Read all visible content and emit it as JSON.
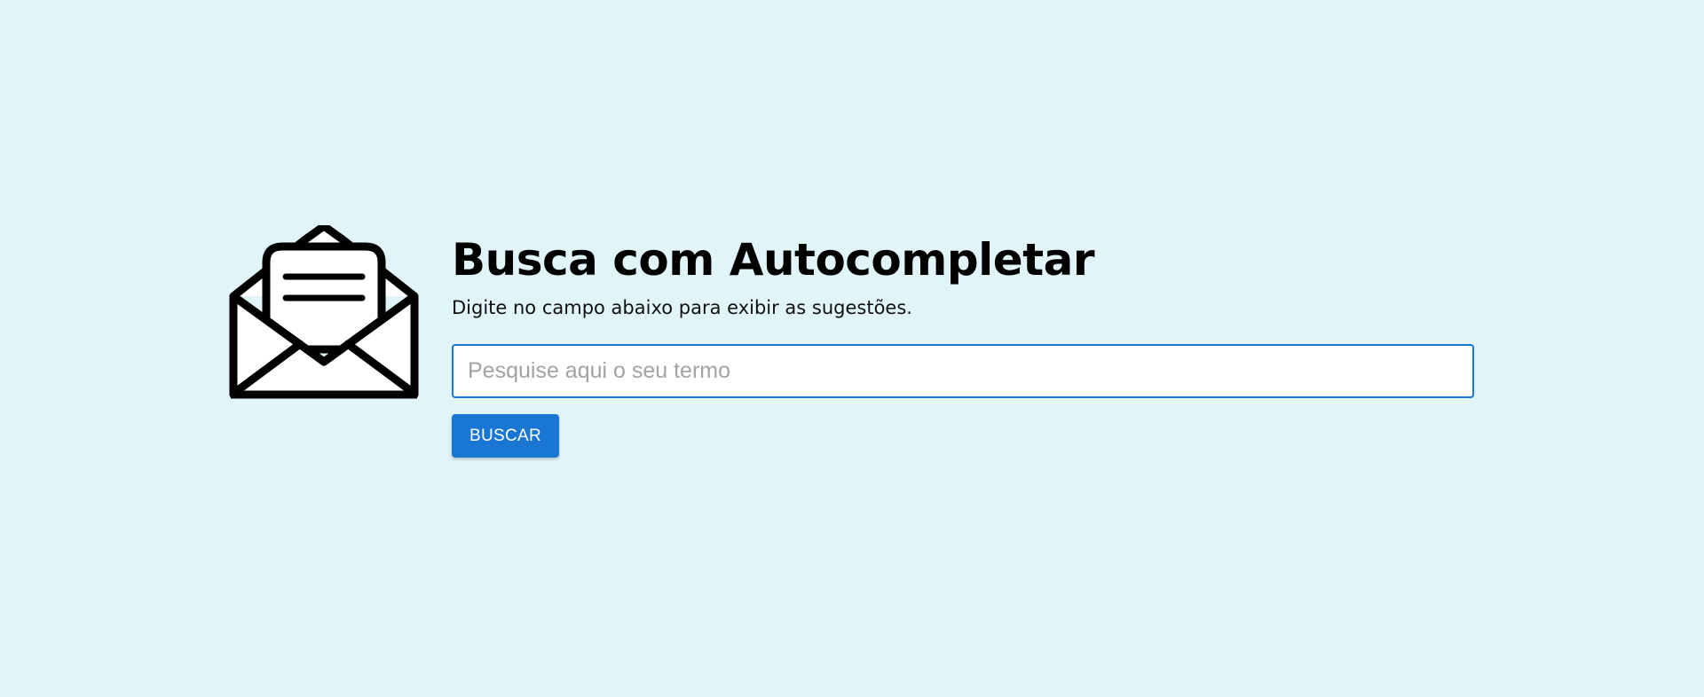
{
  "page": {
    "title": "Busca com Autocompletar",
    "subtitle": "Digite no campo abaixo para exibir as sugestões."
  },
  "search": {
    "placeholder": "Pesquise aqui o seu termo",
    "value": "",
    "button_label": "BUSCAR"
  },
  "icon": {
    "name": "open-envelope-icon"
  },
  "colors": {
    "background": "#e1f4f8",
    "accent": "#1976d2",
    "text": "#000000"
  }
}
